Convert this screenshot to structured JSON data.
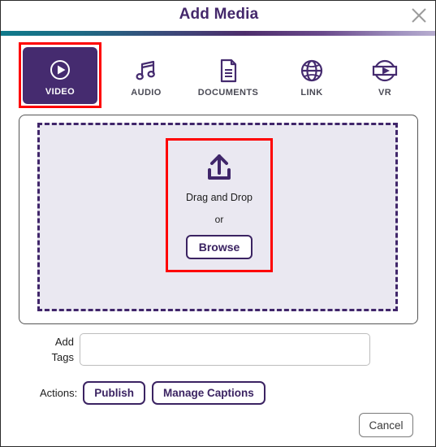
{
  "window": {
    "title": "Add Media",
    "close_icon": "close-icon",
    "accent_purple": "#452b6f",
    "accent_dark_purple": "#3b2362",
    "annotation_color": "#fe0000",
    "gradient_from": "#0f7a8b",
    "gradient_to": "#b8aed0"
  },
  "tabs": [
    {
      "label": "VIDEO",
      "icon": "play-circle-icon",
      "active": true
    },
    {
      "label": "AUDIO",
      "icon": "music-note-icon",
      "active": false
    },
    {
      "label": "DOCUMENTS",
      "icon": "document-icon",
      "active": false
    },
    {
      "label": "LINK",
      "icon": "globe-icon",
      "active": false
    },
    {
      "label": "VR",
      "icon": "vr-sphere-play-icon",
      "active": false
    }
  ],
  "dropzone": {
    "upload_icon": "upload-arrow-tray-icon",
    "drag_text": "Drag and Drop",
    "or_text": "or",
    "browse_label": "Browse"
  },
  "tags": {
    "label_line1": "Add",
    "label_line2": "Tags",
    "value": "",
    "placeholder": ""
  },
  "actions": {
    "label": "Actions:",
    "buttons": [
      {
        "label": "Publish"
      },
      {
        "label": "Manage Captions"
      }
    ]
  },
  "footer": {
    "cancel_label": "Cancel"
  }
}
